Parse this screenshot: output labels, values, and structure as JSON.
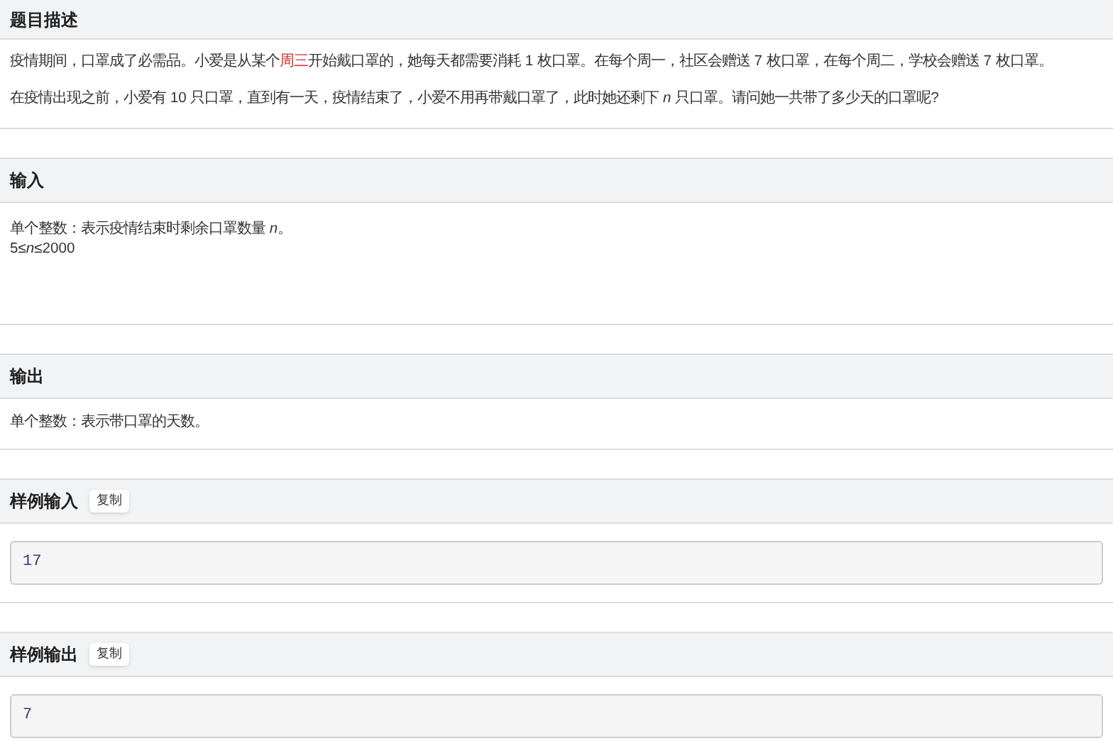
{
  "sections": [
    {
      "title": "题目描述",
      "kind": "text",
      "paragraphs": [
        [
          {
            "text": "疫情期间，口罩成了必需品。小爱是从某个",
            "highlight": false
          },
          {
            "text": "周三",
            "highlight": true
          },
          {
            "text": "开始戴口罩的，她每天都需要消耗 1 枚口罩。在每个周一，社区会赠送 7 枚口罩，在每个周二，学校会赠送 7 枚口罩。",
            "highlight": false
          }
        ],
        [
          {
            "text": "在疫情出现之前，小爱有 10 只口罩，直到有一天，疫情结束了，小爱不用再带戴口罩了，此时她还剩下 *n* 只口罩。请问她一共带了多少天的口罩呢?",
            "highlight": false
          }
        ]
      ]
    },
    {
      "title": "输入",
      "kind": "text",
      "paragraphs": [
        [
          {
            "text": "单个整数：表示疫情结束时剩余口罩数量 *n*。",
            "highlight": false
          }
        ],
        [
          {
            "text": "5≤*n*≤2000",
            "highlight": false
          }
        ]
      ]
    },
    {
      "title": "输出",
      "kind": "text",
      "paragraphs": [
        [
          {
            "text": "单个整数：表示带口罩的天数。",
            "highlight": false
          }
        ]
      ]
    },
    {
      "title": "样例输入",
      "kind": "sample",
      "copy_button": "复制",
      "code": "17"
    },
    {
      "title": "样例输出",
      "kind": "sample",
      "copy_button": "复制",
      "code": "7"
    }
  ]
}
